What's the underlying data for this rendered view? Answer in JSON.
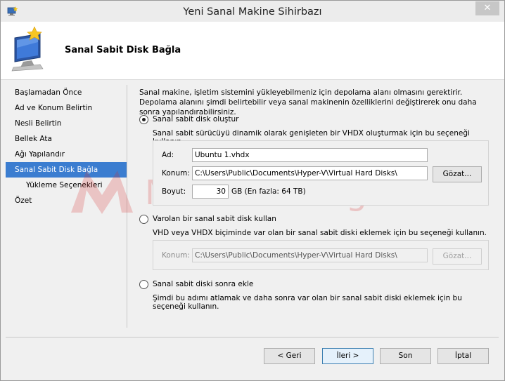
{
  "window": {
    "title": "Yeni Sanal Makine Sihirbazı",
    "close_glyph": "✕"
  },
  "header": {
    "title": "Sanal Sabit Disk Bağla"
  },
  "nav": {
    "items": [
      {
        "label": "Başlamadan Önce"
      },
      {
        "label": "Ad ve Konum Belirtin"
      },
      {
        "label": "Nesli Belirtin"
      },
      {
        "label": "Bellek Ata"
      },
      {
        "label": "Ağı Yapılandır"
      },
      {
        "label": "Sanal Sabit Disk Bağla",
        "active": true
      },
      {
        "label": "Yükleme Seçenekleri",
        "sub": true
      },
      {
        "label": "Özet"
      }
    ]
  },
  "intro_text": "Sanal makine, işletim sistemini yükleyebilmeniz için depolama alanı olmasını gerektirir. Depolama alanını şimdi belirtebilir veya sanal makinenin özelliklerini değiştirerek onu daha sonra yapılandırabilirsiniz.",
  "option_create": {
    "label": "Sanal sabit disk oluştur",
    "selected": true,
    "description": "Sanal sabit sürücüyü dinamik olarak genişleten bir VHDX oluşturmak için bu seçeneği kullanın.",
    "name_label": "Ad:",
    "name_value": "Ubuntu 1.vhdx",
    "location_label": "Konum:",
    "location_value": "C:\\Users\\Public\\Documents\\Hyper-V\\Virtual Hard Disks\\",
    "browse_label": "Gözat...",
    "size_label": "Boyut:",
    "size_value": "30",
    "size_suffix": "GB (En fazla: 64 TB)"
  },
  "option_existing": {
    "label": "Varolan bir sanal sabit disk kullan",
    "selected": false,
    "description": "VHD veya VHDX biçiminde var olan bir sanal sabit diski eklemek için bu seçeneği kullanın.",
    "location_label": "Konum:",
    "location_value": "C:\\Users\\Public\\Documents\\Hyper-V\\Virtual Hard Disks\\",
    "browse_label": "Gözat..."
  },
  "option_later": {
    "label": "Sanal sabit diski sonra ekle",
    "selected": false,
    "description": "Şimdi bu adımı atlamak ve daha sonra var olan bir sanal sabit diski eklemek için bu seçeneği kullanın."
  },
  "buttons": {
    "back": "< Geri",
    "next": "İleri >",
    "finish": "Son",
    "cancel": "İptal"
  },
  "colors": {
    "accent": "#3b7dd0",
    "watermark": "#d92b2b"
  }
}
